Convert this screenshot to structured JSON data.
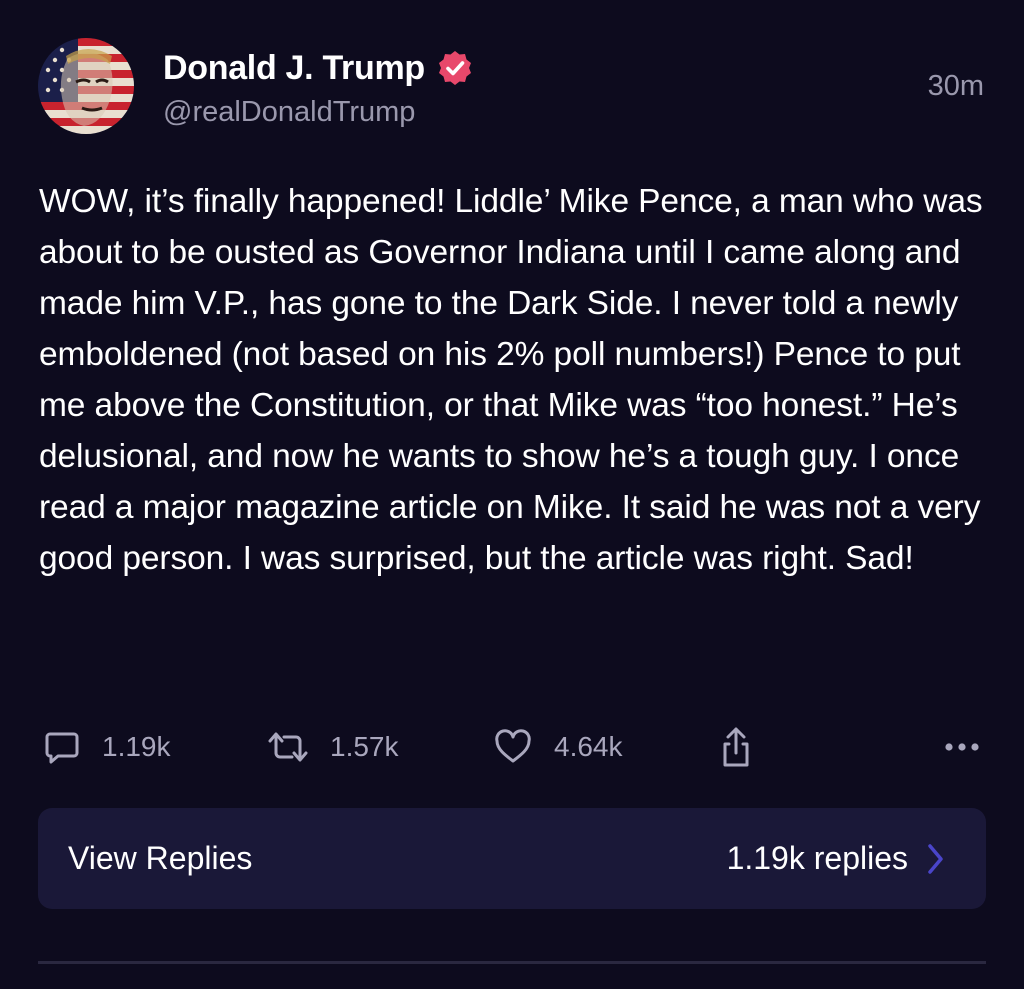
{
  "author": {
    "name": "Donald J. Trump",
    "handle": "@realDonaldTrump",
    "verified": true
  },
  "timestamp": "30m",
  "post_text": "WOW, it’s finally happened! Liddle’ Mike Pence, a man who was about to be ousted as Governor Indiana until I came along and made him V.P., has gone to the Dark Side. I never told a newly emboldened (not based on his 2% poll numbers!) Pence to put me above the Constitution, or that Mike was “too honest.” He’s delusional, and now he wants to show he’s a tough guy. I once read a major magazine article on Mike. It said he was not a very good person. I was surprised, but the article was right. Sad!",
  "actions": {
    "reply_count": "1.19k",
    "retruth_count": "1.57k",
    "like_count": "4.64k"
  },
  "replies_bar": {
    "label": "View Replies",
    "count_text": "1.19k replies"
  },
  "colors": {
    "background": "#0d0b1e",
    "card": "#1a1838",
    "muted_text": "#9a98ad",
    "verified_badge": "#e8486b",
    "chevron": "#4a45c9"
  },
  "icons": [
    "reply-icon",
    "retruth-icon",
    "like-icon",
    "share-icon",
    "more-icon",
    "chevron-right-icon",
    "verified-icon"
  ]
}
